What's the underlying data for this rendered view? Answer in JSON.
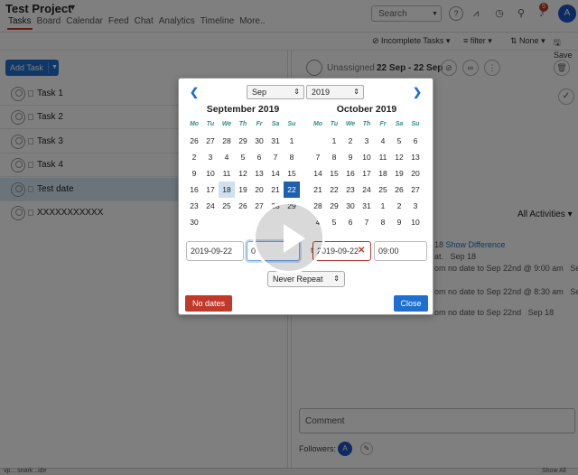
{
  "header": {
    "project_title": "Test Project",
    "tabs": [
      {
        "label": "Tasks",
        "active": true
      },
      {
        "label": "Board"
      },
      {
        "label": "Calendar"
      },
      {
        "label": "Feed"
      },
      {
        "label": "Chat"
      },
      {
        "label": "Analytics"
      },
      {
        "label": "Timeline"
      },
      {
        "label": "More.."
      }
    ],
    "search_label": "Search",
    "notification_count": "5",
    "user_initial": "A"
  },
  "filterbar": {
    "incomplete": "Incomplete Tasks",
    "filter": "filter",
    "sort": "None",
    "save": "Save"
  },
  "tasks": {
    "add_label": "Add Task",
    "items": [
      {
        "label": "Task 1"
      },
      {
        "label": "Task 2"
      },
      {
        "label": "Task 3"
      },
      {
        "label": "Task 4"
      },
      {
        "label": "Test date"
      },
      {
        "label": "XXXXXXXXXXX"
      }
    ]
  },
  "detail": {
    "assignee": "Unassigned",
    "date_range": "22 Sep - 22 Sep",
    "all_activities": "All Activities",
    "activity_lines": [
      "18",
      "Show Difference",
      "at.",
      "Sep 18",
      "om no date to Sep 22nd @ 9:00 am",
      "Sep",
      "om no date to Sep 22nd @ 8:30 am",
      "Sep",
      "om no date to Sep 22nd",
      "Sep 18"
    ],
    "comment_placeholder": "Comment",
    "followers_label": "Followers:",
    "follower_initial": "A"
  },
  "footer": {
    "left_text": "vp...  snark  ..ide",
    "right_text": "Show All"
  },
  "datepicker": {
    "month_select": "Sep",
    "year_select": "2019",
    "weekdays": [
      "Mo",
      "Tu",
      "We",
      "Th",
      "Fr",
      "Sa",
      "Su"
    ],
    "left_calendar": {
      "title": "September 2019",
      "weeks": [
        [
          "26",
          "27",
          "28",
          "29",
          "30",
          "31",
          "1"
        ],
        [
          "2",
          "3",
          "4",
          "5",
          "6",
          "7",
          "8"
        ],
        [
          "9",
          "10",
          "11",
          "12",
          "13",
          "14",
          "15"
        ],
        [
          "16",
          "17",
          "18",
          "19",
          "20",
          "21",
          "22"
        ],
        [
          "23",
          "24",
          "25",
          "26",
          "27",
          "28",
          "29"
        ],
        [
          "30",
          "",
          "",
          "",
          "",
          "",
          ""
        ]
      ],
      "today": "18",
      "selected": "22"
    },
    "right_calendar": {
      "title": "October 2019",
      "weeks": [
        [
          "",
          "1",
          "2",
          "3",
          "4",
          "5",
          "6"
        ],
        [
          "7",
          "8",
          "9",
          "10",
          "11",
          "12",
          "13"
        ],
        [
          "14",
          "15",
          "16",
          "17",
          "18",
          "19",
          "20"
        ],
        [
          "21",
          "22",
          "23",
          "24",
          "25",
          "26",
          "27"
        ],
        [
          "28",
          "29",
          "30",
          "31",
          "1",
          "2",
          "3"
        ],
        [
          "4",
          "5",
          "6",
          "7",
          "8",
          "9",
          "10"
        ]
      ]
    },
    "start_date": "2019-09-22",
    "start_time": "0",
    "to_label": "to",
    "end_date": "2019-09-22",
    "end_time": "09:00",
    "repeat": "Never Repeat",
    "no_dates_label": "No dates",
    "close_label": "Close"
  },
  "colors": {
    "primary": "#1e6fcf",
    "danger": "#c0392b",
    "selected_day": "#1e5fb0"
  }
}
